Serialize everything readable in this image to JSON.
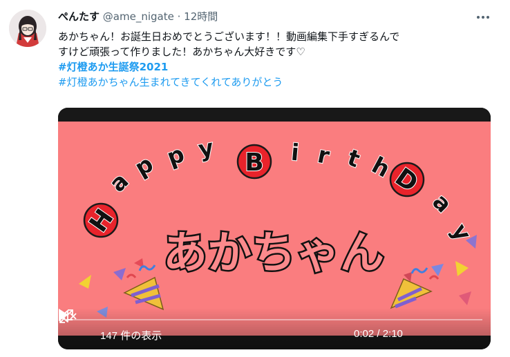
{
  "user": {
    "display_name": "ぺんたす",
    "handle": "@ame_nigate",
    "separator": "·",
    "time": "12時間"
  },
  "more_icon": "more-horizontal-icon",
  "tweet": {
    "line1": "あかちゃん！お誕生日おめでとうございます！！動画編集下手すぎるんで",
    "line2": "すけど頑張って作りました！あかちゃん大好きです♡",
    "hashtags": [
      "#灯橙あか生誕祭2021",
      "#灯橙あかちゃん生まれてきてくれてありがとう"
    ]
  },
  "video": {
    "title_latin": [
      "H",
      "a",
      "p",
      "p",
      "y",
      "B",
      "i",
      "r",
      "t",
      "h",
      "D",
      "a",
      "y"
    ],
    "title_jp": "あかちゃん",
    "views": "147 件の表示",
    "time_display": "0:02 / 2:10",
    "progress": 0.015,
    "colors": {
      "background": "#fa7d7f",
      "circle": "#e8232b",
      "bar": "#1a1a1a"
    }
  }
}
